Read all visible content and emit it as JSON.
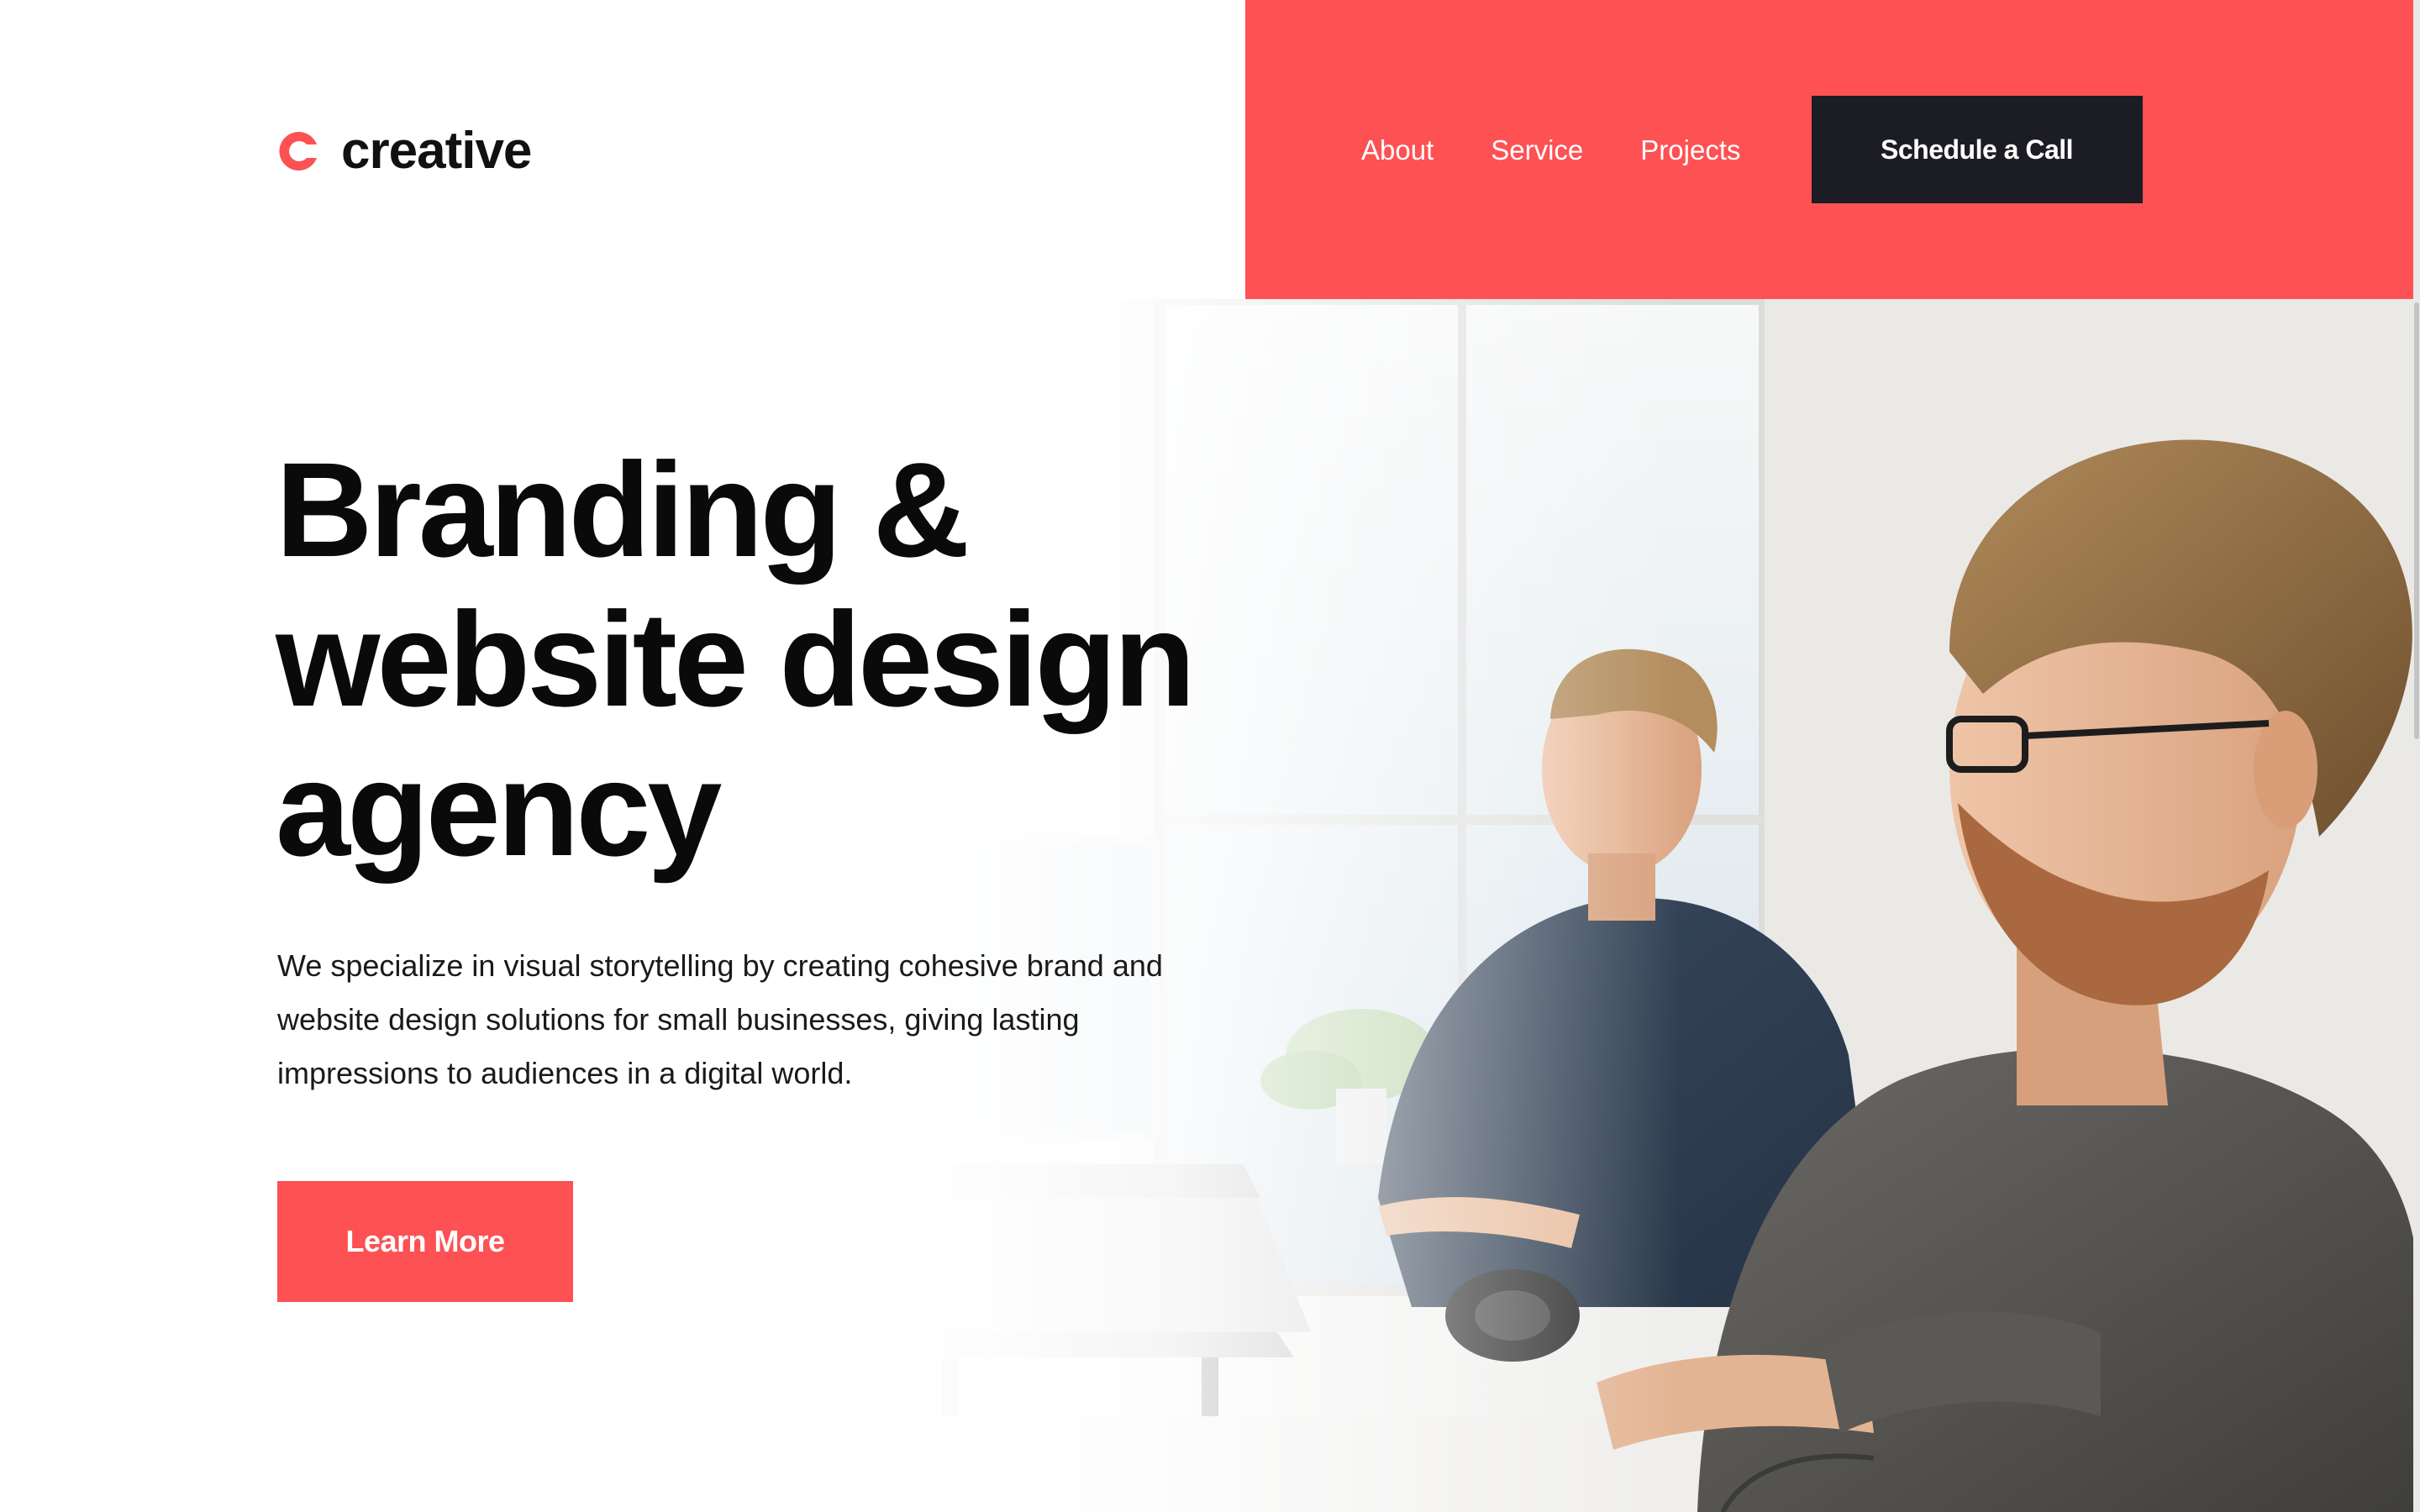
{
  "brand": {
    "logo_text": "creative",
    "logo_icon": "c-logo-icon",
    "accent_color": "#fd5154",
    "dark_color": "#1c1c24"
  },
  "nav": {
    "items": [
      {
        "label": "About"
      },
      {
        "label": "Service"
      },
      {
        "label": "Projects"
      }
    ],
    "cta_label": "Schedule a Call"
  },
  "hero": {
    "headline_lines": [
      "Branding &",
      "website design",
      "agency"
    ],
    "description_lines": [
      "We specialize in visual storytelling by creating cohesive brand and",
      "website design solutions for small businesses, giving lasting",
      "impressions to audiences in a digital world."
    ],
    "button_label": "Learn More",
    "image": "photo of two men working at computers in an office"
  }
}
